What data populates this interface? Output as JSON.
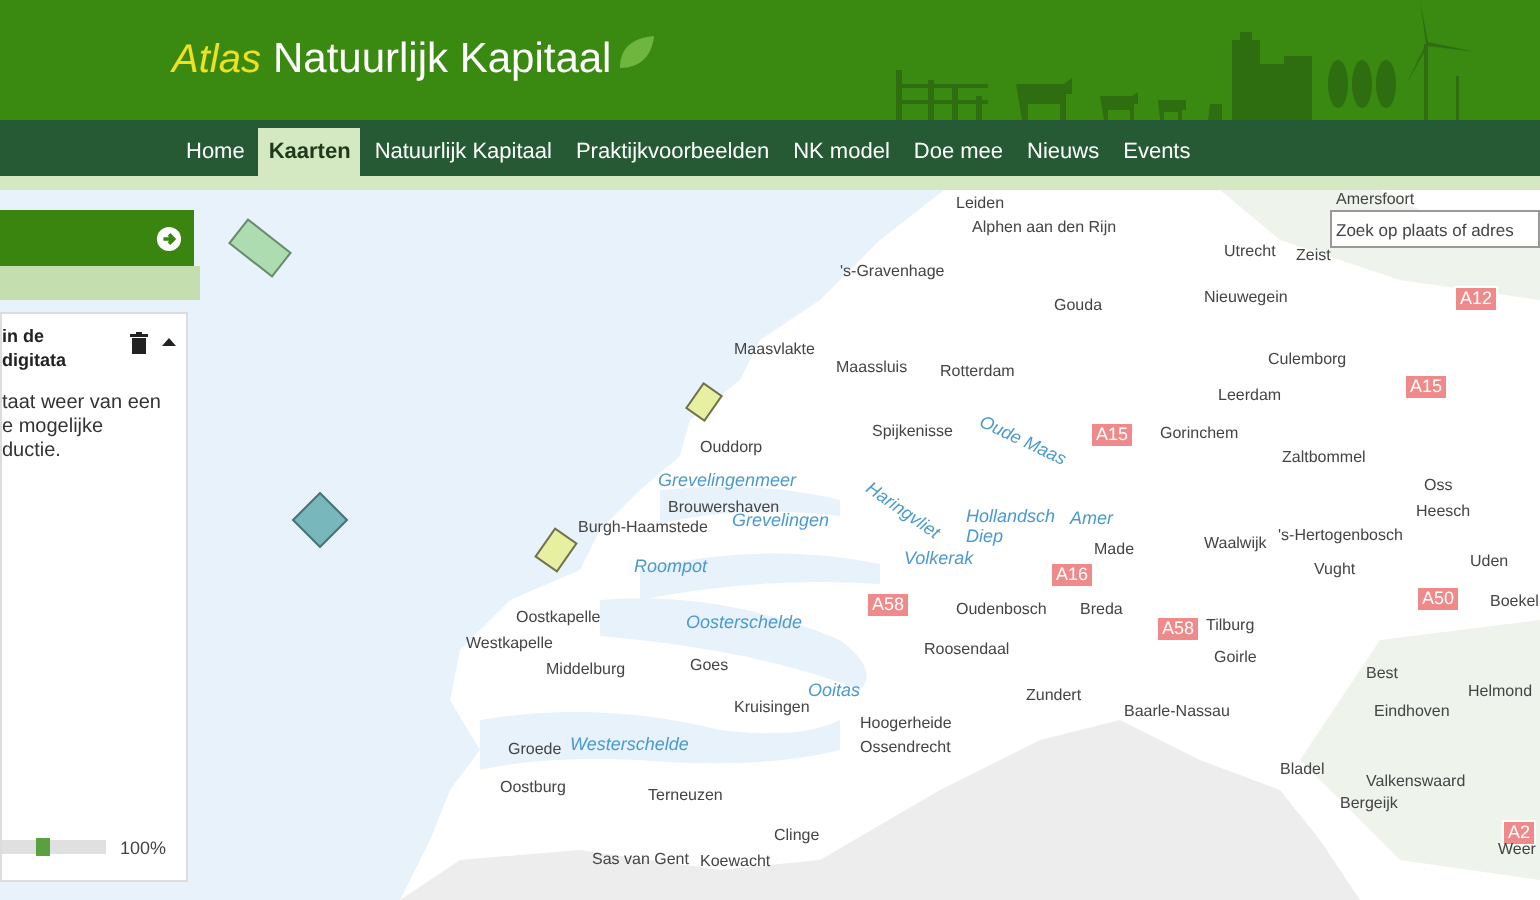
{
  "header": {
    "title_prefix": "Atlas",
    "title": "Natuurlijk Kapitaal"
  },
  "nav": [
    {
      "label": "Home",
      "selected": false
    },
    {
      "label": "Kaarten",
      "selected": true
    },
    {
      "label": "Natuurlijk Kapitaal",
      "selected": false
    },
    {
      "label": "Praktijkvoorbeelden",
      "selected": false
    },
    {
      "label": "NK model",
      "selected": false
    },
    {
      "label": "Doe mee",
      "selected": false
    },
    {
      "label": "Nieuws",
      "selected": false
    },
    {
      "label": "Events",
      "selected": false
    }
  ],
  "layer_card": {
    "title": "in de\ndigitata",
    "description": "taat weer van een\ne mogelijke\nductie.",
    "opacity": {
      "level": 0.4,
      "reading": "100%"
    }
  },
  "map": {
    "search": {
      "placeholder": "Zoek op plaats of adres"
    },
    "labels": [
      {
        "text": "Amersfoort",
        "kind": "place"
      },
      {
        "text": "Leiden",
        "kind": "place"
      },
      {
        "text": "Alphen aan den Rijn",
        "kind": "place"
      },
      {
        "text": "Utrecht",
        "kind": "place"
      },
      {
        "text": "Zeist",
        "kind": "place"
      },
      {
        "text": "'s-Gravenhage",
        "kind": "place"
      },
      {
        "text": "Gouda",
        "kind": "place"
      },
      {
        "text": "Nieuwegein",
        "kind": "place"
      },
      {
        "text": "A12",
        "kind": "road"
      },
      {
        "text": "Maasvlakte",
        "kind": "place"
      },
      {
        "text": "Maassluis",
        "kind": "place"
      },
      {
        "text": "Rotterdam",
        "kind": "place"
      },
      {
        "text": "Culemborg",
        "kind": "place"
      },
      {
        "text": "A15",
        "kind": "road"
      },
      {
        "text": "Leerdam",
        "kind": "place"
      },
      {
        "text": "Ouddorp",
        "kind": "place"
      },
      {
        "text": "Spijkenisse",
        "kind": "place"
      },
      {
        "text": "Oude Maas",
        "kind": "water"
      },
      {
        "text": "A15",
        "kind": "road"
      },
      {
        "text": "Gorinchem",
        "kind": "place"
      },
      {
        "text": "Zaltbommel",
        "kind": "place"
      },
      {
        "text": "Grevelingenmeer",
        "kind": "water"
      },
      {
        "text": "Oss",
        "kind": "place"
      },
      {
        "text": "Brouwershaven",
        "kind": "place"
      },
      {
        "text": "Grevelingen",
        "kind": "water"
      },
      {
        "text": "Haringvliet",
        "kind": "water"
      },
      {
        "text": "Hollandsch",
        "kind": "water"
      },
      {
        "text": "Amer",
        "kind": "water"
      },
      {
        "text": "Heesch",
        "kind": "place"
      },
      {
        "text": "Burgh-Haamstede",
        "kind": "place"
      },
      {
        "text": "Diep",
        "kind": "water"
      },
      {
        "text": "'s-Hertogenbosch",
        "kind": "place"
      },
      {
        "text": "Made",
        "kind": "place"
      },
      {
        "text": "Waalwijk",
        "kind": "place"
      },
      {
        "text": "Roompot",
        "kind": "water"
      },
      {
        "text": "Volkerak",
        "kind": "water"
      },
      {
        "text": "A16",
        "kind": "road"
      },
      {
        "text": "Vught",
        "kind": "place"
      },
      {
        "text": "Uden",
        "kind": "place"
      },
      {
        "text": "A58",
        "kind": "road"
      },
      {
        "text": "Oudenbosch",
        "kind": "place"
      },
      {
        "text": "Breda",
        "kind": "place"
      },
      {
        "text": "A50",
        "kind": "road"
      },
      {
        "text": "Boekel",
        "kind": "place"
      },
      {
        "text": "Oostkapelle",
        "kind": "place"
      },
      {
        "text": "Oosterschelde",
        "kind": "water"
      },
      {
        "text": "A58",
        "kind": "road"
      },
      {
        "text": "Tilburg",
        "kind": "place"
      },
      {
        "text": "Westkapelle",
        "kind": "place"
      },
      {
        "text": "Roosendaal",
        "kind": "place"
      },
      {
        "text": "Middelburg",
        "kind": "place"
      },
      {
        "text": "Goes",
        "kind": "place"
      },
      {
        "text": "Goirle",
        "kind": "place"
      },
      {
        "text": "Best",
        "kind": "place"
      },
      {
        "text": "Ooitas",
        "kind": "water"
      },
      {
        "text": "Zundert",
        "kind": "place"
      },
      {
        "text": "Helmond",
        "kind": "place"
      },
      {
        "text": "Kruisingen",
        "kind": "place"
      },
      {
        "text": "Baarle-Nassau",
        "kind": "place"
      },
      {
        "text": "Eindhoven",
        "kind": "place"
      },
      {
        "text": "Hoogerheide",
        "kind": "place"
      },
      {
        "text": "Groede",
        "kind": "place"
      },
      {
        "text": "Westerschelde",
        "kind": "water"
      },
      {
        "text": "Ossendrecht",
        "kind": "place"
      },
      {
        "text": "Bladel",
        "kind": "place"
      },
      {
        "text": "Oostburg",
        "kind": "place"
      },
      {
        "text": "Valkenswaard",
        "kind": "place"
      },
      {
        "text": "Terneuzen",
        "kind": "place"
      },
      {
        "text": "Bergeijk",
        "kind": "place"
      },
      {
        "text": "Clinge",
        "kind": "place"
      },
      {
        "text": "A2",
        "kind": "road"
      },
      {
        "text": "Weer",
        "kind": "place"
      },
      {
        "text": "Sas van Gent",
        "kind": "place"
      },
      {
        "text": "Koewacht",
        "kind": "place"
      }
    ]
  }
}
